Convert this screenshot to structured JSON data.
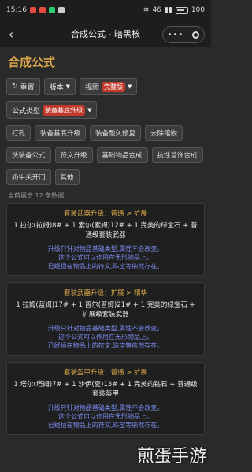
{
  "status": {
    "time": "15:16",
    "signal": "46",
    "battery": "100"
  },
  "window": {
    "title": "合成公式 - 暗黑核"
  },
  "heading": "合成公式",
  "controls": {
    "reset": "重置",
    "version": "版本",
    "view": "视图",
    "view_badge": "完整版",
    "formula_type": "公式类型",
    "formula_badge": "装备基底升级"
  },
  "tags_row1": [
    "打孔",
    "装备基底升级",
    "装备耐久修复",
    "去除镶嵌"
  ],
  "tags_row2": [
    "洗装备公式",
    "符文升级",
    "基础物品合成",
    "抗性首饰合成"
  ],
  "tags_row3": [
    "奶牛关开门",
    "其他"
  ],
  "count_text": "当前展示 12 条数据",
  "cards": [
    {
      "title": "套装武器升级：普通 > 扩展",
      "formula": "1 拉尔(拉姆)8# + 1 索尔(索姆)12# + 1 完美的绿宝石 + 普通级套装武器",
      "notes": [
        "升级只针对物品基础类型,属性不会改变。",
        "这个公式可以作用在无形物品上。",
        "已经插在物品上的符文,珠宝等依然存在。"
      ]
    },
    {
      "title": "套装武器升级：扩展 > 精华",
      "formula": "1 拉姆(蓝姆)17# + 1 普尔(普姆)21# + 1 完美的绿宝石 + 扩展级套装武器",
      "notes": [
        "升级只针对物品基础类型,属性不会改变。",
        "这个公式可以作用在无形物品上。",
        "已经插在物品上的符文,珠宝等依然存在。"
      ]
    },
    {
      "title": "套装盔甲升级：普通 > 扩展",
      "formula": "1 塔尔(塔姆)7# + 1 沙伊(夏)13# + 1 完美的钻石 + 普通级套装盔甲",
      "notes": [
        "升级只针对物品基础类型,属性不会改变。",
        "这个公式可以作用在无形物品上。",
        "已经插在物品上的符文,珠宝等依然存在。"
      ]
    }
  ],
  "watermark": "煎蛋手游",
  "colors": {
    "accent": "#d9a84a",
    "note": "#7b8bf0",
    "badge": "#c0392b"
  }
}
